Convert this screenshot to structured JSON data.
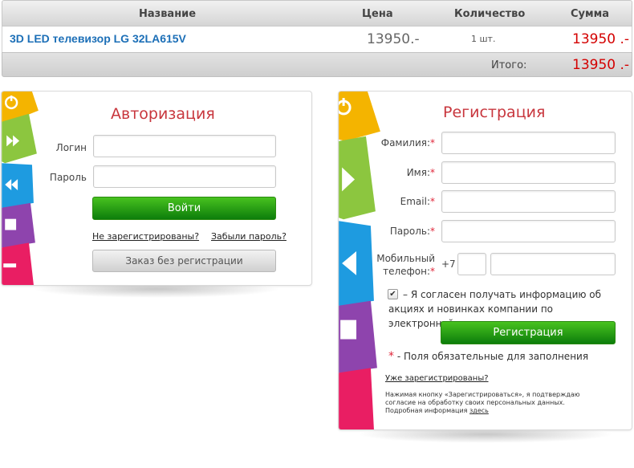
{
  "cart": {
    "headers": {
      "name": "Название",
      "price": "Цена",
      "qty": "Количество",
      "sum": "Сумма"
    },
    "item": {
      "name": "3D LED телевизор LG 32LA615V",
      "price": "13950.-",
      "qty": "1 шт.",
      "sum": "13950 .-"
    },
    "total_label": "Итого:",
    "total_value": "13950 .-"
  },
  "auth": {
    "title": "Авторизация",
    "login_label": "Логин",
    "password_label": "Пароль",
    "login_value": "",
    "password_value": "",
    "submit_label": "Войти",
    "not_registered_link": "Не зарегистрированы?",
    "forgot_link": "Забыли пароль?",
    "guest_order_label": "Заказ без регистрации"
  },
  "register": {
    "title": "Регистрация",
    "surname_label": "Фамилия:",
    "name_label": "Имя:",
    "email_label": "Email:",
    "password_label": "Пароль:",
    "phone_label_1": "Мобильный",
    "phone_label_2": "телефон:",
    "required_mark": "*",
    "phone_prefix": "+7",
    "agree_checked": true,
    "agree_text": "– Я согласен получать информацию об акциях и новинках компании по электронной почте",
    "submit_label": "Регистрация",
    "required_note": "- Поля обязательные для заполнения",
    "already_registered_link": "Уже зарегистрированы?",
    "consent_text": "Нажимая кнопку «Зарегистрироваться», я подтверждаю согласие на обработку своих персональных данных. Подробная информация",
    "consent_link": "здесь"
  },
  "colors": {
    "accent_title": "#c8363d",
    "link_blue": "#1c6fb7",
    "price_red": "#d40000",
    "button_green": "#2fa112",
    "tile_yellow": "#f4b400",
    "tile_green": "#8cc63f",
    "tile_blue": "#1e9be0",
    "tile_purple": "#8e44ad",
    "tile_pink": "#e91e63"
  },
  "icons": {
    "auth_tiles": [
      "power-icon",
      "fast-forward-icon",
      "rewind-icon",
      "stop-icon",
      "minus-icon"
    ],
    "reg_tiles": [
      "power-icon",
      "play-icon",
      "back-icon",
      "stop-icon"
    ]
  }
}
